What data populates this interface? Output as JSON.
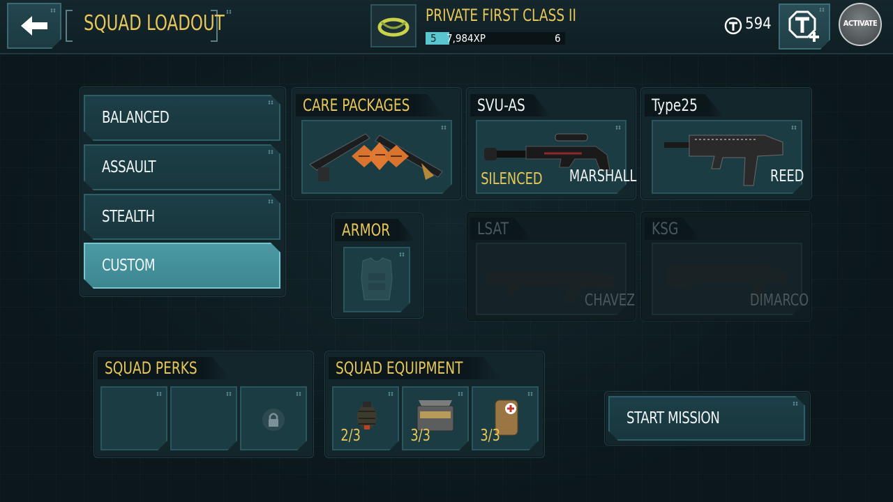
{
  "header": {
    "title": "SQUAD LOADOUT",
    "rank_title": "PRIVATE FIRST CLASS II",
    "xp_level": "5",
    "xp_value": "7,984XP",
    "next_level": "6",
    "xp_progress": 0.17,
    "currency": "594",
    "activate_label": "ACTIVATE"
  },
  "sidebar": {
    "items": [
      {
        "label": "BALANCED"
      },
      {
        "label": "ASSAULT"
      },
      {
        "label": "STEALTH"
      },
      {
        "label": "CUSTOM"
      }
    ],
    "selected": "CUSTOM"
  },
  "loadout": {
    "care_packages": {
      "title": "CARE PACKAGES"
    },
    "armor": {
      "title": "ARMOR"
    },
    "weapons": [
      {
        "name": "SVU-AS",
        "tag": "SILENCED",
        "owner": "MARSHALL",
        "enabled": true
      },
      {
        "name": "Type25",
        "tag": "",
        "owner": "REED",
        "enabled": true
      },
      {
        "name": "LSAT",
        "tag": "",
        "owner": "CHAVEZ",
        "enabled": false
      },
      {
        "name": "KSG",
        "tag": "",
        "owner": "DIMARCO",
        "enabled": false
      }
    ]
  },
  "perks": {
    "title": "SQUAD PERKS"
  },
  "equipment": {
    "title": "SQUAD EQUIPMENT",
    "items": [
      {
        "icon": "grenade-icon",
        "count": "2/3"
      },
      {
        "icon": "ammo-crate-icon",
        "count": "3/3"
      },
      {
        "icon": "medkit-icon",
        "count": "3/3"
      }
    ]
  },
  "actions": {
    "start_mission": "START MISSION"
  },
  "colors": {
    "accent_yellow": "#e8c75a",
    "accent_teal": "#4a9aa4",
    "xp_bar": "#5bc6d0"
  }
}
